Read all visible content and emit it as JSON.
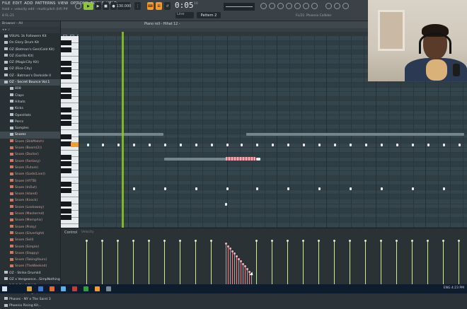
{
  "menu": [
    "FILE",
    "EDIT",
    "ADD",
    "PATTERNS",
    "VIEW",
    "OPTIONS",
    "TOOLS",
    "HELP"
  ],
  "hint": "Hold + velocity edit - multi-pitch (Hf) P#",
  "memo": "8 FL-21",
  "toolbar": {
    "tempo": "130.000",
    "time": "0:05",
    "time_sub": "10",
    "pattern": "Pattern 2",
    "mode": "Line",
    "news": "FL/21: Phoenix Collider"
  },
  "piano_roll": {
    "title": "Piano roll - Hihat 12 -",
    "control_label": "Control",
    "control_sub": "Velocity"
  },
  "browser": {
    "header": "Browser - All",
    "header2": "◂ ▸ ⌕",
    "items": [
      {
        "label": "VSUAL 1k Followers Kit",
        "type": "folder"
      },
      {
        "label": "On Glory Drum Kit",
        "type": "folder"
      },
      {
        "label": "OZ (Batman's Gen)Cold Kit)",
        "type": "folder"
      },
      {
        "label": "OZ (Gorilla Kit)",
        "type": "folder"
      },
      {
        "label": "OZ (MagicCity Kit)",
        "type": "folder"
      },
      {
        "label": "OZ (Rice City)",
        "type": "folder"
      },
      {
        "label": "OZ - Batman's Darkside II",
        "type": "folder"
      },
      {
        "label": "OZ - Secret Bounce Vol.1",
        "type": "folder",
        "selected": true
      },
      {
        "label": "808",
        "type": "sub"
      },
      {
        "label": "Claps",
        "type": "sub"
      },
      {
        "label": "Hihats",
        "type": "sub"
      },
      {
        "label": "Kicks",
        "type": "sub"
      },
      {
        "label": "OpenHats",
        "type": "sub"
      },
      {
        "label": "Percs",
        "type": "sub"
      },
      {
        "label": "Samples",
        "type": "sub"
      },
      {
        "label": "Snares",
        "type": "sub",
        "selected": true
      },
      {
        "label": "Snare (StikMatch)",
        "type": "file"
      },
      {
        "label": "Snare (Boom(2))",
        "type": "file"
      },
      {
        "label": "Snare (Doctor)",
        "type": "file"
      },
      {
        "label": "Snare (Fantasy)",
        "type": "file"
      },
      {
        "label": "Snare (Future)",
        "type": "file"
      },
      {
        "label": "Snare (Gods(Live))",
        "type": "file"
      },
      {
        "label": "Snare (HYTB)",
        "type": "file"
      },
      {
        "label": "Snare (InOut)",
        "type": "file"
      },
      {
        "label": "Snare (Island)",
        "type": "file"
      },
      {
        "label": "Snare (Knock)",
        "type": "file"
      },
      {
        "label": "Snare (Lookaway)",
        "type": "file"
      },
      {
        "label": "Snare (Mastermd)",
        "type": "file"
      },
      {
        "label": "Snare (Memphis)",
        "type": "file"
      },
      {
        "label": "Snare (Pinky)",
        "type": "file"
      },
      {
        "label": "Snare (Silverlight)",
        "type": "file"
      },
      {
        "label": "Snare (Sell)",
        "type": "file"
      },
      {
        "label": "Snare (Simple)",
        "type": "file"
      },
      {
        "label": "Snare (Sloppy)",
        "type": "file"
      },
      {
        "label": "Snare (TakingYours)",
        "type": "file"
      },
      {
        "label": "Snare (TheWeeknd)",
        "type": "file"
      },
      {
        "label": "OZ - Strike Drumkit",
        "type": "folder"
      },
      {
        "label": "OZ x Vengeance...SimpNothing Kit",
        "type": "folder"
      },
      {
        "label": "P R O D I C T Y D",
        "type": "folder"
      },
      {
        "label": "Pharaoh (tonight)",
        "type": "folder"
      },
      {
        "label": "Phases - NY x The Saint 3",
        "type": "folder"
      },
      {
        "label": "Phoenix Rising Kit...",
        "type": "folder"
      }
    ]
  },
  "tray": "ENG  4:23 PM",
  "colors": {
    "accent": "#8fc43f",
    "highlight": "#f29b2e",
    "grid": "#34454d",
    "velocity": "#cfe3b9",
    "slide": "#d98890"
  }
}
